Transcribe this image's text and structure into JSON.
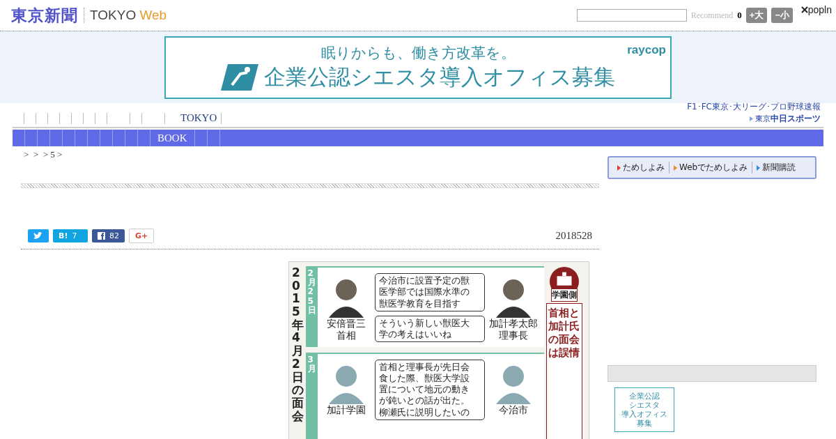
{
  "header": {
    "logo": "東京新聞",
    "site": "TOKYO",
    "site_accent": "Web",
    "recommend": "Recommend",
    "count": "0",
    "font_buttons": [
      "+大",
      "−小"
    ],
    "popin": "popln"
  },
  "ad": {
    "headline": "眠りからも、働き方改革を。",
    "title": "企業公認シエスタ導入オフィス募集",
    "brand": "raycop"
  },
  "nav": {
    "primary": [
      "TOKYO"
    ],
    "secondary": [
      "BOOK"
    ]
  },
  "sports": {
    "caption": "F1･FC東京･大リーグ･プロ野球速報",
    "small": "東京",
    "big": "中日スポーツ"
  },
  "breadcrumb": ">  >  > 5 >",
  "subscribe": [
    {
      "label": "ためしよみ",
      "color": "#e03a2e"
    },
    {
      "label": "Webでためしよみ",
      "color": "#ef8a2a"
    },
    {
      "label": "新聞購読",
      "color": "#2a8ee0"
    }
  ],
  "share": [
    {
      "kind": "twitter"
    },
    {
      "kind": "hatena",
      "label": "B!",
      "count": "7"
    },
    {
      "kind": "facebook",
      "count": "82"
    },
    {
      "kind": "google",
      "label": "G+"
    }
  ],
  "date": "2018528",
  "infographic": {
    "title": "2015年4月2日の面会",
    "side_label": "学園側",
    "side_text": "首相と加計氏の面会は誤情",
    "panels": [
      {
        "date": "2月25日",
        "left_name": [
          "安倍晋三",
          "首相"
        ],
        "right_name": [
          "加計孝太郎",
          "理事長"
        ],
        "bubbles": [
          [
            "今治市に設置予定の獣",
            "医学部では国際水準の",
            "獣医学教育を目指す"
          ],
          [
            "そういう新しい獣医大",
            "学の考えはいいね"
          ]
        ]
      },
      {
        "date": "3月",
        "left_name": [
          "加計学園"
        ],
        "right_name": [
          "今治市"
        ],
        "bubbles": [
          [
            "首相と理事長が先日会",
            "食した際、獣医大学設",
            "置について地元の動き",
            "が鈍いとの話が出た。",
            "柳瀬氏に説明したいの"
          ]
        ]
      }
    ]
  },
  "sidebar_ad": {
    "lines": [
      "企業公認",
      "シエスタ",
      "導入オフィス",
      "募集"
    ]
  }
}
